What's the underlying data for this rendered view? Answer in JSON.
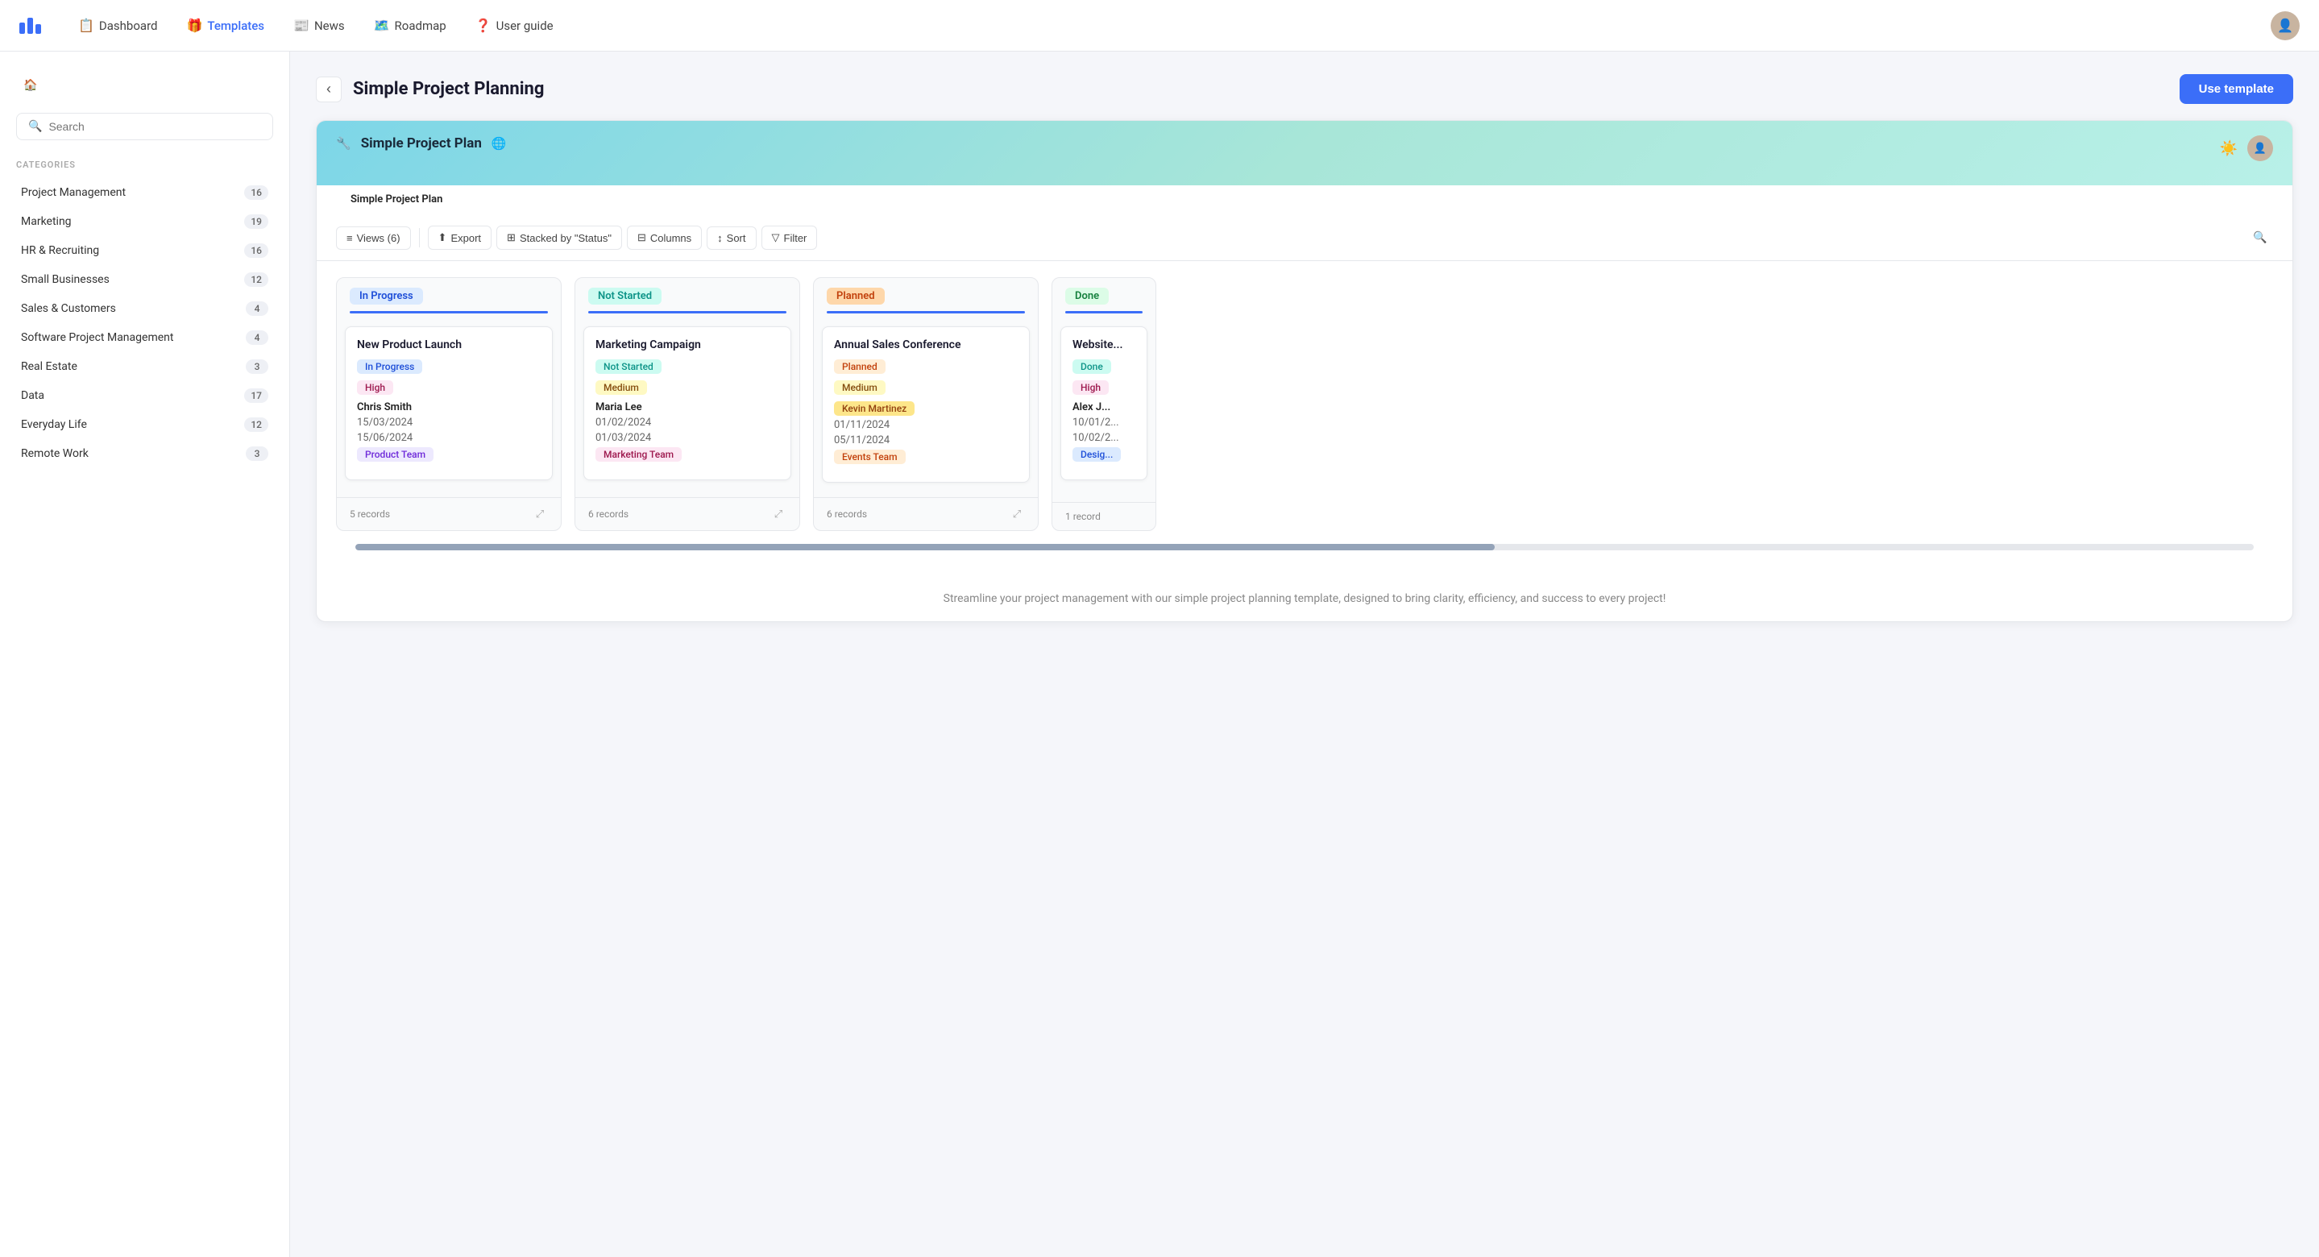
{
  "nav": {
    "logo_alt": "App Logo",
    "items": [
      {
        "id": "dashboard",
        "label": "Dashboard",
        "icon": "📋",
        "active": false
      },
      {
        "id": "templates",
        "label": "Templates",
        "icon": "🎁",
        "active": true
      },
      {
        "id": "news",
        "label": "News",
        "icon": "📰",
        "active": false
      },
      {
        "id": "roadmap",
        "label": "Roadmap",
        "icon": "🗺️",
        "active": false
      },
      {
        "id": "user-guide",
        "label": "User guide",
        "icon": "❓",
        "active": false
      }
    ]
  },
  "sidebar": {
    "search_placeholder": "Search",
    "categories_label": "CATEGORIES",
    "categories": [
      {
        "name": "Project Management",
        "count": 16
      },
      {
        "name": "Marketing",
        "count": 19
      },
      {
        "name": "HR & Recruiting",
        "count": 16
      },
      {
        "name": "Small Businesses",
        "count": 12
      },
      {
        "name": "Sales & Customers",
        "count": 4
      },
      {
        "name": "Software Project Management",
        "count": 4
      },
      {
        "name": "Real Estate",
        "count": 3
      },
      {
        "name": "Data",
        "count": 17
      },
      {
        "name": "Everyday Life",
        "count": 12
      },
      {
        "name": "Remote Work",
        "count": 3
      }
    ]
  },
  "main": {
    "back_title": "Back",
    "page_title": "Simple Project Planning",
    "use_template_label": "Use template",
    "description": "Streamline your project management with our simple project planning template, designed to bring clarity, efficiency, and success to every project!"
  },
  "preview": {
    "title": "Simple Project Plan",
    "tab_label": "Simple Project Plan",
    "toolbar": {
      "views_label": "Views (6)",
      "export_label": "Export",
      "stacked_label": "Stacked by \"Status\"",
      "columns_label": "Columns",
      "sort_label": "Sort",
      "filter_label": "Filter"
    },
    "columns": [
      {
        "id": "in-progress",
        "tag": "In Progress",
        "tag_class": "in-progress",
        "records": "5 records",
        "cards": [
          {
            "title": "New Product Launch",
            "status_badge": "In Progress",
            "status_class": "badge-blue",
            "priority": "High",
            "priority_class": "badge-pink",
            "assignee": "Chris Smith",
            "start_date": "15/03/2024",
            "end_date": "15/06/2024",
            "team": "Product Team",
            "team_class": "badge-purple"
          }
        ]
      },
      {
        "id": "not-started",
        "tag": "Not Started",
        "tag_class": "not-started",
        "records": "6 records",
        "cards": [
          {
            "title": "Marketing Campaign",
            "status_badge": "Not Started",
            "status_class": "badge-green",
            "priority": "Medium",
            "priority_class": "badge-yellow",
            "assignee": "Maria Lee",
            "start_date": "01/02/2024",
            "end_date": "01/03/2024",
            "team": "Marketing Team",
            "team_class": "badge-pink"
          }
        ]
      },
      {
        "id": "planned",
        "tag": "Planned",
        "tag_class": "planned",
        "records": "6 records",
        "cards": [
          {
            "title": "Annual Sales Conference",
            "status_badge": "Planned",
            "status_class": "badge-orange",
            "priority": "Medium",
            "priority_class": "badge-yellow",
            "assignee": "Kevin Martinez",
            "assignee_class": "badge-amber",
            "start_date": "01/11/2024",
            "end_date": "05/11/2024",
            "team": "Events Team",
            "team_class": "badge-orange"
          }
        ]
      },
      {
        "id": "done",
        "tag": "Done",
        "tag_class": "done",
        "records": "1 record",
        "partial": true,
        "cards": [
          {
            "title": "Website...",
            "status_badge": "Done",
            "status_class": "badge-green",
            "priority": "High",
            "priority_class": "badge-pink",
            "assignee": "Alex J...",
            "start_date": "10/01/2...",
            "end_date": "10/02/2...",
            "team": "Desig...",
            "team_class": "badge-blue"
          }
        ]
      }
    ]
  }
}
